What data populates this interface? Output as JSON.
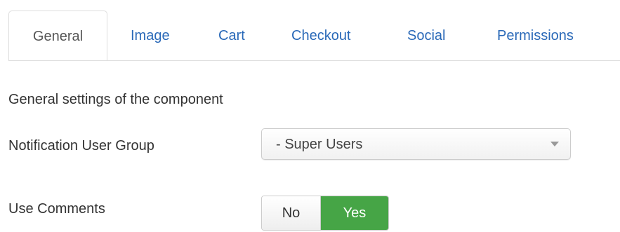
{
  "tabs": [
    {
      "label": "General",
      "active": true
    },
    {
      "label": "Image",
      "active": false
    },
    {
      "label": "Cart",
      "active": false
    },
    {
      "label": "Checkout",
      "active": false
    },
    {
      "label": "Social",
      "active": false
    },
    {
      "label": "Permissions",
      "active": false
    }
  ],
  "section": {
    "description": "General settings of the component"
  },
  "fields": {
    "notification_group": {
      "label": "Notification User Group",
      "value": "- Super Users"
    },
    "use_comments": {
      "label": "Use Comments",
      "options": [
        "No",
        "Yes"
      ],
      "selected": "Yes"
    }
  },
  "colors": {
    "link": "#2a69b8",
    "active_yes": "#46a546",
    "border": "#dddddd"
  }
}
